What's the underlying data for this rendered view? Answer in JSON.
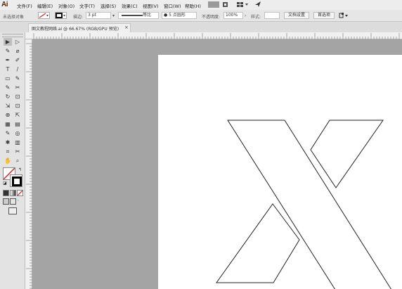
{
  "app": {
    "logo": "Ai"
  },
  "menu": {
    "items": [
      "文件(F)",
      "编辑(E)",
      "对象(O)",
      "文字(T)",
      "选择(S)",
      "效果(C)",
      "视图(V)",
      "窗口(W)",
      "帮助(H)"
    ]
  },
  "control_bar": {
    "selection_label": "未选择对象",
    "stroke_label": "描边:",
    "stroke_value": "3 pt",
    "stroke_style": "等比",
    "brush_label": "5 点圆形",
    "opacity_label": "不透明度:",
    "opacity_value": "100%",
    "style_label": "样式:",
    "doc_setup_button": "文档设置",
    "preferences_button": "首选项"
  },
  "document_tab": {
    "title": "图文教程网络.ai @ 66.67% (RGB/GPU 预览)",
    "close": "×"
  },
  "toolbar": {
    "tools": [
      [
        "▶",
        "▷"
      ],
      [
        "✎",
        "⌀"
      ],
      [
        "✒",
        "✐"
      ],
      [
        "T",
        "/"
      ],
      [
        "▭",
        "✎"
      ],
      [
        "✎",
        "✂"
      ],
      [
        "↻",
        "⊡"
      ],
      [
        "⇲",
        "⊡"
      ],
      [
        "⊕",
        "⇱"
      ],
      [
        "▦",
        "▤"
      ],
      [
        "✎",
        "◎"
      ],
      [
        "✱",
        "▥"
      ],
      [
        "⌗",
        "✂"
      ],
      [
        "✋",
        "⌕"
      ]
    ]
  },
  "colors": {
    "ui_bg": "#e3e3e3",
    "canvas_bg": "#a4a4a4",
    "artboard": "#ffffff",
    "stroke": "#222222",
    "none_slash": "#e02020"
  }
}
